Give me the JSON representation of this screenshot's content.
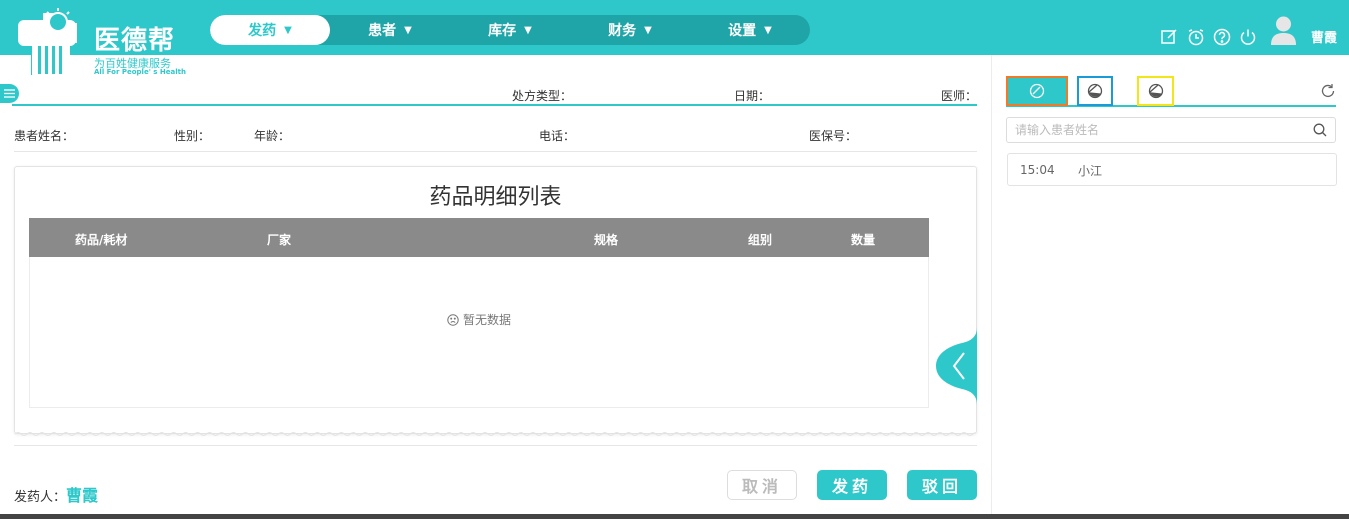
{
  "app": {
    "name": "医德帮",
    "slogan": "为百姓健康服务",
    "slogan_en": "All For People' s Health",
    "brand_color": "#2ec8cb"
  },
  "nav": {
    "items": [
      {
        "label": "发药",
        "active": true
      },
      {
        "label": "患者",
        "active": false
      },
      {
        "label": "库存",
        "active": false
      },
      {
        "label": "财务",
        "active": false
      },
      {
        "label": "设置",
        "active": false
      }
    ]
  },
  "header_icons": [
    "edit-icon",
    "alarm-icon",
    "help-icon",
    "power-icon"
  ],
  "user": {
    "name": "曹霞"
  },
  "prescription": {
    "type_label": "处方类型：",
    "date_label": "日期：",
    "doctor_label": "医师："
  },
  "patient_info": {
    "name_label": "患者姓名：",
    "gender_label": "性别：",
    "age_label": "年龄：",
    "phone_label": "电话：",
    "insurance_label": "医保号："
  },
  "drug_table": {
    "title": "药品明细列表",
    "columns": [
      "药品/耗材",
      "厂家",
      "规格",
      "组别",
      "数量"
    ],
    "rows": [],
    "empty_text": "暂无数据"
  },
  "footer": {
    "dispenser_label": "发药人：",
    "dispenser_name": "曹霞",
    "cancel_label": "取消",
    "dispense_label": "发药",
    "reject_label": "驳回"
  },
  "right_panel": {
    "tab_icons": [
      "pill-icon",
      "pill-icon",
      "pill-icon"
    ],
    "tab_border_colors": [
      "#f07a25",
      "#1a9ad6",
      "#f2e51a"
    ],
    "search_placeholder": "请输入患者姓名",
    "patients": [
      {
        "time": "15:04",
        "name": "小江"
      }
    ]
  }
}
